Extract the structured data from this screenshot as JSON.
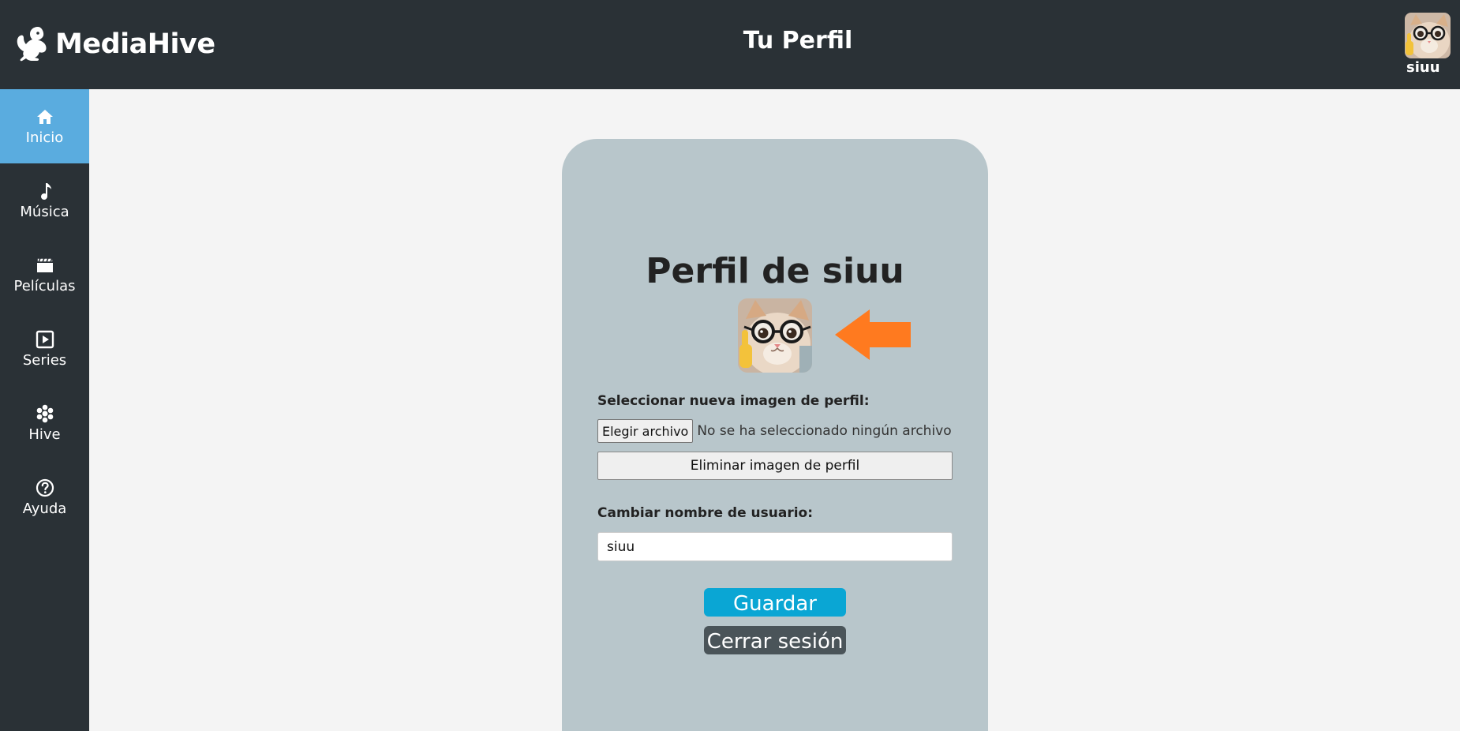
{
  "app": {
    "name": "MediaHive",
    "logo_icon": "squirrel-logo-icon"
  },
  "header": {
    "title": "Tu Perfil",
    "username": "siuu",
    "avatar_icon": "cat-avatar-icon"
  },
  "sidebar": {
    "active_color": "#5aacdf",
    "items": [
      {
        "label": "Inicio",
        "icon": "home-icon",
        "active": true
      },
      {
        "label": "Música",
        "icon": "music-note-icon",
        "active": false
      },
      {
        "label": "Películas",
        "icon": "film-icon",
        "active": false
      },
      {
        "label": "Series",
        "icon": "play-square-icon",
        "active": false
      },
      {
        "label": "Hive",
        "icon": "hive-icon",
        "active": false
      },
      {
        "label": "Ayuda",
        "icon": "help-circle-icon",
        "active": false
      }
    ]
  },
  "profile": {
    "title": "Perfil de siuu",
    "picture_icon": "cat-avatar-icon",
    "arrow_icon": "arrow-left-icon",
    "arrow_color": "#ff7a1f",
    "image_label": "Seleccionar nueva imagen de perfil:",
    "file_button": "Elegir archivo",
    "file_status": "No se ha seleccionado ningún archivo",
    "remove_button": "Eliminar imagen de perfil",
    "username_label": "Cambiar nombre de usuario:",
    "username_value": "siuu",
    "save_button": "Guardar",
    "save_color": "#0aa6d4",
    "logout_button": "Cerrar sesión",
    "logout_color": "#4a5459"
  }
}
